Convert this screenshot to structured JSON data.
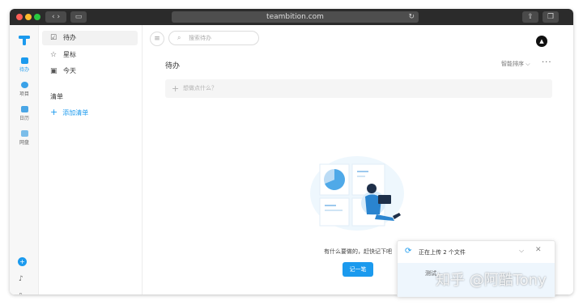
{
  "browser": {
    "url": "teambition.com",
    "reload_icon": "reload-icon",
    "controls": [
      "back-icon",
      "forward-icon",
      "sidebar-icon",
      "share-icon",
      "tabs-icon"
    ]
  },
  "rail": {
    "logo_icon": "teambition-logo-icon",
    "items": [
      {
        "label": "待办",
        "icon": "todo-icon",
        "active": true
      },
      {
        "label": "项目",
        "icon": "project-icon",
        "active": false
      },
      {
        "label": "日历",
        "icon": "calendar-icon",
        "active": false
      },
      {
        "label": "网盘",
        "icon": "folder-icon",
        "active": false
      }
    ],
    "bottom_icons": [
      "add-icon",
      "bell-icon",
      "search-icon"
    ]
  },
  "nav": {
    "items": [
      {
        "label": "待办",
        "icon": "checkbox-icon",
        "selected": true
      },
      {
        "label": "星标",
        "icon": "star-icon",
        "selected": false
      },
      {
        "label": "今天",
        "icon": "calendar-today-icon",
        "selected": false
      }
    ],
    "list_header": "清单",
    "add_list": "添加清单"
  },
  "main": {
    "search_placeholder": "搜索待办",
    "title": "待办",
    "sort_label": "智能排序 ⌵",
    "more_icon": "more-icon",
    "new_task_placeholder": "想做点什么？",
    "empty_text": "有什么要做的，赶快记下吧",
    "note_button": "记一笔"
  },
  "upload": {
    "title": "正在上传 2 个文件",
    "file_label": "测试",
    "sync_icon": "sync-icon",
    "collapse_icon": "chevron-down-icon",
    "close_icon": "close-icon"
  },
  "watermark": "知乎 @阿酷Tony",
  "colors": {
    "accent": "#1b9aee",
    "titlebar": "#2b2b2b",
    "rail_bg": "#f7f7f7",
    "input_bg": "#f5f5f5"
  }
}
